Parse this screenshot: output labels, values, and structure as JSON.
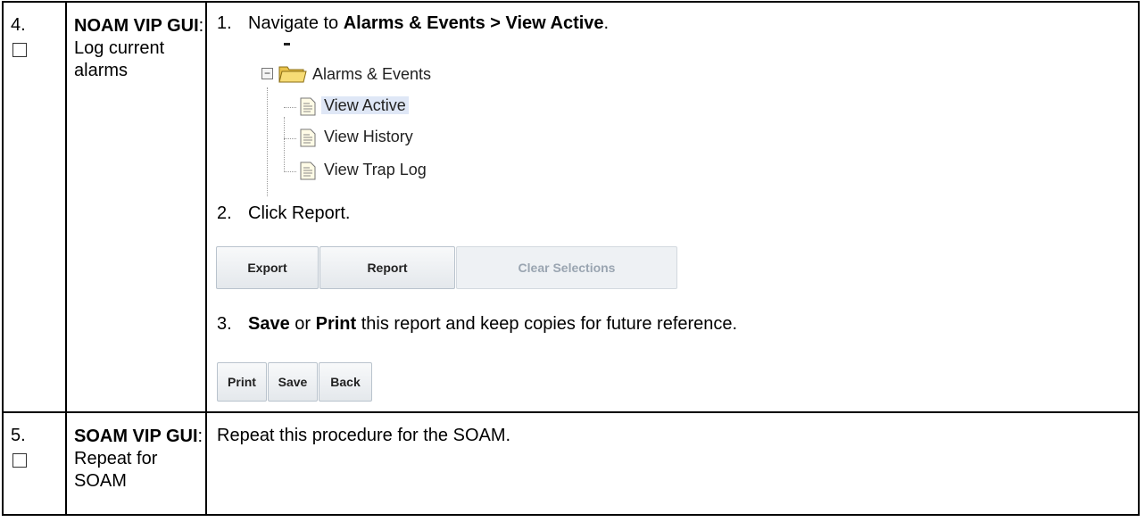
{
  "steps": [
    {
      "number": "4.",
      "title_bold": "NOAM VIP GUI",
      "title_colon": ":",
      "title_rest": "Log current alarms",
      "instructions": {
        "s1_num": "1.",
        "s1_text": "Navigate to ",
        "s1_bold": "Alarms & Events > View Active",
        "s1_end": ".",
        "tree": {
          "folder": "Alarms & Events",
          "items": [
            "View Active",
            "View History",
            "View Trap Log"
          ],
          "selected": "View Active"
        },
        "s2_num": "2.",
        "s2_text": "Click Report.",
        "buttons_row1": [
          "Export",
          "Report",
          "Clear Selections"
        ],
        "s3_num": "3.",
        "s3_bold1": "Save",
        "s3_mid": " or ",
        "s3_bold2": "Print",
        "s3_rest": " this report and keep copies for future reference.",
        "buttons_row2": [
          "Print",
          "Save",
          "Back"
        ]
      }
    },
    {
      "number": "5.",
      "title_bold": "SOAM VIP GUI",
      "title_colon": ":",
      "title_rest": "Repeat for SOAM",
      "text": "Repeat this procedure for the SOAM."
    }
  ]
}
